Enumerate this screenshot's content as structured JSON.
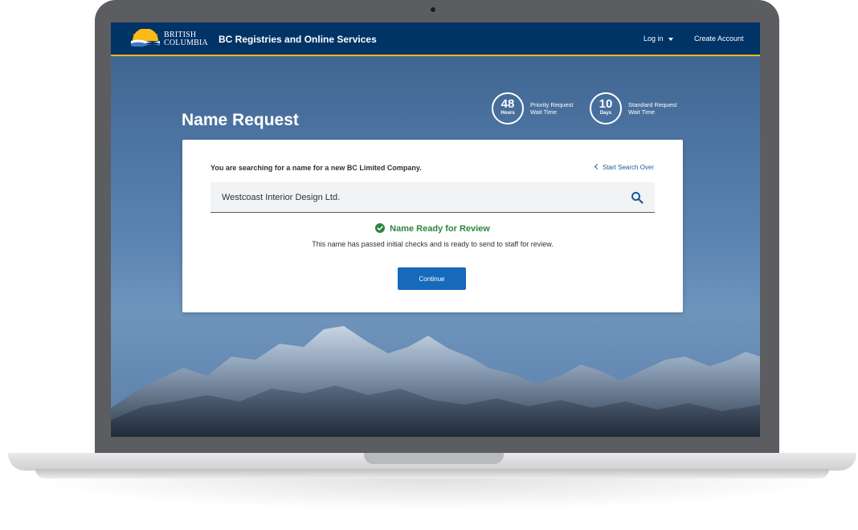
{
  "header": {
    "logo": {
      "line1": "BRITISH",
      "line2": "COLUMBIA"
    },
    "app_title": "BC Registries and Online Services",
    "login_label": "Log in",
    "create_account_label": "Create Account"
  },
  "page": {
    "title": "Name Request"
  },
  "wait_times": [
    {
      "number": "48",
      "unit": "Hours",
      "label_line1": "Priority Request",
      "label_line2": "Wait Time"
    },
    {
      "number": "10",
      "unit": "Days",
      "label_line1": "Standard Request",
      "label_line2": "Wait Time"
    }
  ],
  "card": {
    "heading": "You are searching for a name for a new BC Limited Company.",
    "start_over_label": "Start Search Over",
    "search_value": "Westcoast Interior Design Ltd.",
    "status_title": "Name Ready for Review",
    "status_description": "This name has passed initial checks and is ready to send to staff for review.",
    "continue_label": "Continue"
  },
  "colors": {
    "header_bg": "#003366",
    "header_accent": "#fcba19",
    "primary_button": "#1669bb",
    "success": "#2e8540",
    "link": "#1a5a96"
  },
  "icons": {
    "logo": "bc-sun-logo",
    "search": "magnifier",
    "status": "check-circle",
    "back": "chevron-left",
    "dropdown": "caret-down"
  }
}
